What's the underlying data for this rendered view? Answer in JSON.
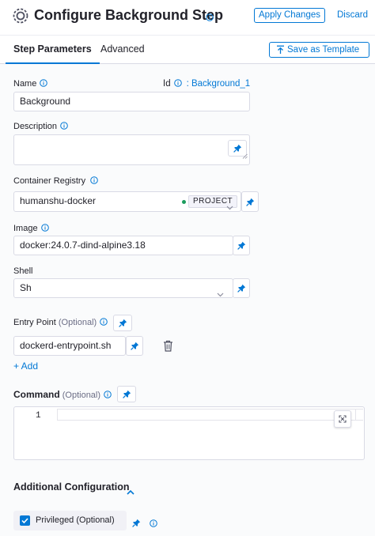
{
  "header": {
    "title": "Configure Background Step",
    "apply_label": "Apply Changes",
    "discard_label": "Discard"
  },
  "tabs": [
    {
      "label": "Step Parameters",
      "active": true
    },
    {
      "label": "Advanced",
      "active": false
    }
  ],
  "save_template_label": "Save as Template",
  "fields": {
    "name": {
      "label": "Name",
      "value": "Background"
    },
    "id": {
      "label": "Id",
      "value": ": Background_1"
    },
    "description": {
      "label": "Description",
      "value": ""
    },
    "container_registry": {
      "label": "Container Registry",
      "value": "humanshu-docker",
      "scope_badge": "PROJECT"
    },
    "image": {
      "label": "Image",
      "value": "docker:24.0.7-dind-alpine3.18"
    },
    "shell": {
      "label": "Shell",
      "value": "Sh"
    },
    "entry_point": {
      "label": "Entry Point",
      "optional": "(Optional)",
      "items": [
        "dockerd-entrypoint.sh"
      ],
      "add_label": "+ Add"
    },
    "command": {
      "label": "Command",
      "optional": "(Optional)",
      "line_number": "1"
    }
  },
  "additional": {
    "title": "Additional Configuration",
    "privileged": {
      "label": "Privileged (Optional)",
      "checked": true
    }
  },
  "colors": {
    "accent": "#0278d5",
    "status_green": "#1b9c5d",
    "text": "#22222a",
    "border": "#d9dae5"
  },
  "icons": [
    "step-logo-icon",
    "info-icon",
    "upload-icon",
    "pin-icon",
    "chevron-down-icon",
    "trash-icon",
    "expand-icon",
    "chevron-up-icon",
    "check-icon",
    "resize-grip-icon"
  ]
}
